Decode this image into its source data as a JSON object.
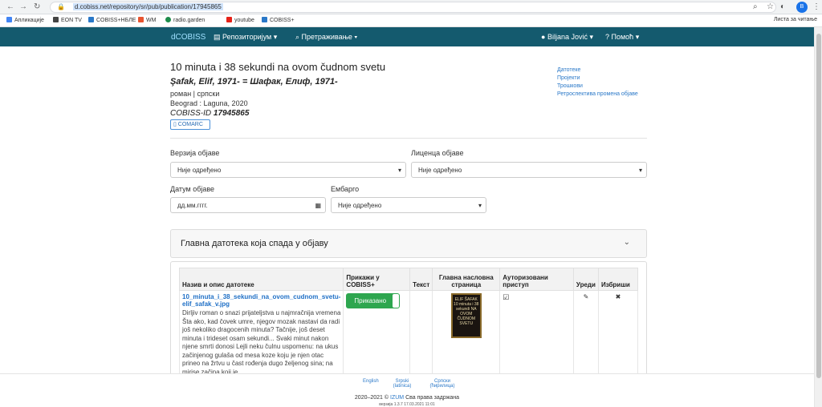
{
  "browser": {
    "url": "d.cobiss.net/repository/sr/pub/publication/17945865",
    "avatar_letter": "B",
    "bookmarks": [
      "Апликације",
      "EON TV",
      "COBISS+НБЛЕ",
      "WM",
      "radio.garden",
      "youtube",
      "COBISS+"
    ],
    "reading_list": "Листа за читање"
  },
  "navbar": {
    "brand": "dCOBISS",
    "repositories": "Репозиторијум",
    "search": "Претраживање",
    "user": "Biljana Jović",
    "help": "Помоћ"
  },
  "publication": {
    "title": "10 minuta i 38 sekundi na ovom čudnom svetu",
    "author": "Şafak, Elif, 1971- = Шафак, Елиф, 1971-",
    "type": "роман | српски",
    "imprint": "Beograd : Laguna, 2020",
    "cobiss_label": "COBISS-ID",
    "cobiss_id": "17945865",
    "comarc": "COMARC"
  },
  "side_links": [
    "Датотеке",
    "Пројекти",
    "Трошкови",
    "Ретроспектива промена објаве"
  ],
  "form": {
    "version_label": "Верзија објаве",
    "version_value": "Није одређено",
    "license_label": "Лиценца објаве",
    "license_value": "Није одређено",
    "date_label": "Датум објаве",
    "date_placeholder": "дд.мм.гггг.",
    "embargo_label": "Ембарго",
    "embargo_value": "Није одређено"
  },
  "panel": {
    "title": "Главна датотека која спада у објаву"
  },
  "table": {
    "headers": [
      "Назив и опис датотеке",
      "Прикажи у COBISS+",
      "Текст",
      "Главна насловна страница",
      "Ауторизовани приступ",
      "Уреди",
      "Избриши"
    ],
    "row": {
      "file_name": "10_minuta_i_38_sekundi_na_ovom_cudnom_svetu-elif_safak_v.jpg",
      "description": "Dirljiv roman o snazi prijateljstva u najmračnija vremena Šta ako, kad čovek umre, njegov mozak nastavi da radi još nekoliko dragocenih minuta? Tačnije, još deset minuta i trideset osam sekundi... Svaki minut nakon njene smrti donosi Lejli neku čulnu uspomenu: na ukus začinjenog gulaša od mesa koze koju je njen otac prineo na žrtvu u čast rođenja dugo željenog sina; na mirise začina koji je",
      "toggle_label": "Приказано",
      "cover_text": "ELIF ŠAFAK 10 minuta i 38 sekundi NA OVOM ČUDNOM SVETU"
    }
  },
  "footer": {
    "lang_en": "English",
    "lang_sr_latn": "Srpski (latinica)",
    "lang_sr_cyrl": "Српски (ћирилица)",
    "copyright_years": "2020–2021 ©",
    "copyright_org": "IZUM",
    "copyright_text": "Сва права задржана",
    "version": "верзија 1.3.7 17.03.2021 11:01"
  }
}
